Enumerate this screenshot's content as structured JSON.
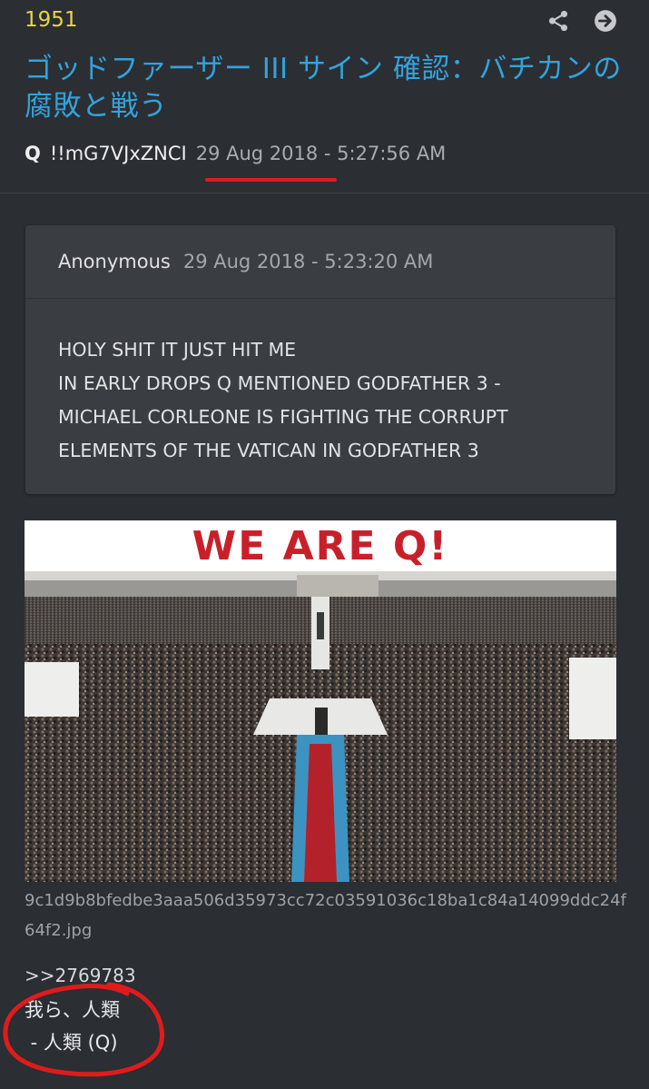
{
  "post": {
    "number": "1951",
    "title": "ゴッドファーザー III サイン 確認：バチカンの腐敗と戦う",
    "author": "Q",
    "tripcode": "!!mG7VJxZNCI",
    "date": "29 Aug 2018 - 5:27:56 AM",
    "reply_link": ">>2769783",
    "text_lines": [
      "我ら、人類",
      " - 人類 (Q)"
    ]
  },
  "quote": {
    "author": "Anonymous",
    "date": "29 Aug 2018 - 5:23:20 AM",
    "lines": [
      "HOLY SHIT IT JUST HIT ME",
      "IN EARLY DROPS Q MENTIONED GODFATHER 3 -",
      "MICHAEL CORLEONE IS FIGHTING THE CORRUPT",
      "ELEMENTS OF THE VATICAN IN GODFATHER 3"
    ]
  },
  "media": {
    "banner_text": "WE ARE Q!",
    "filename": "9c1d9b8bfedbe3aaa506d35973cc72c03591036c18ba1c84a14099ddc24f64f2.jpg"
  },
  "icons": {
    "share": "share-icon",
    "next": "arrow-right-circle-icon"
  },
  "colors": {
    "background": "#2b2e33",
    "post_number": "#e7d742",
    "title": "#33a3dc",
    "card": "#3a3d42",
    "annotation_red": "#e01b1b",
    "banner_red": "#c8202a"
  }
}
